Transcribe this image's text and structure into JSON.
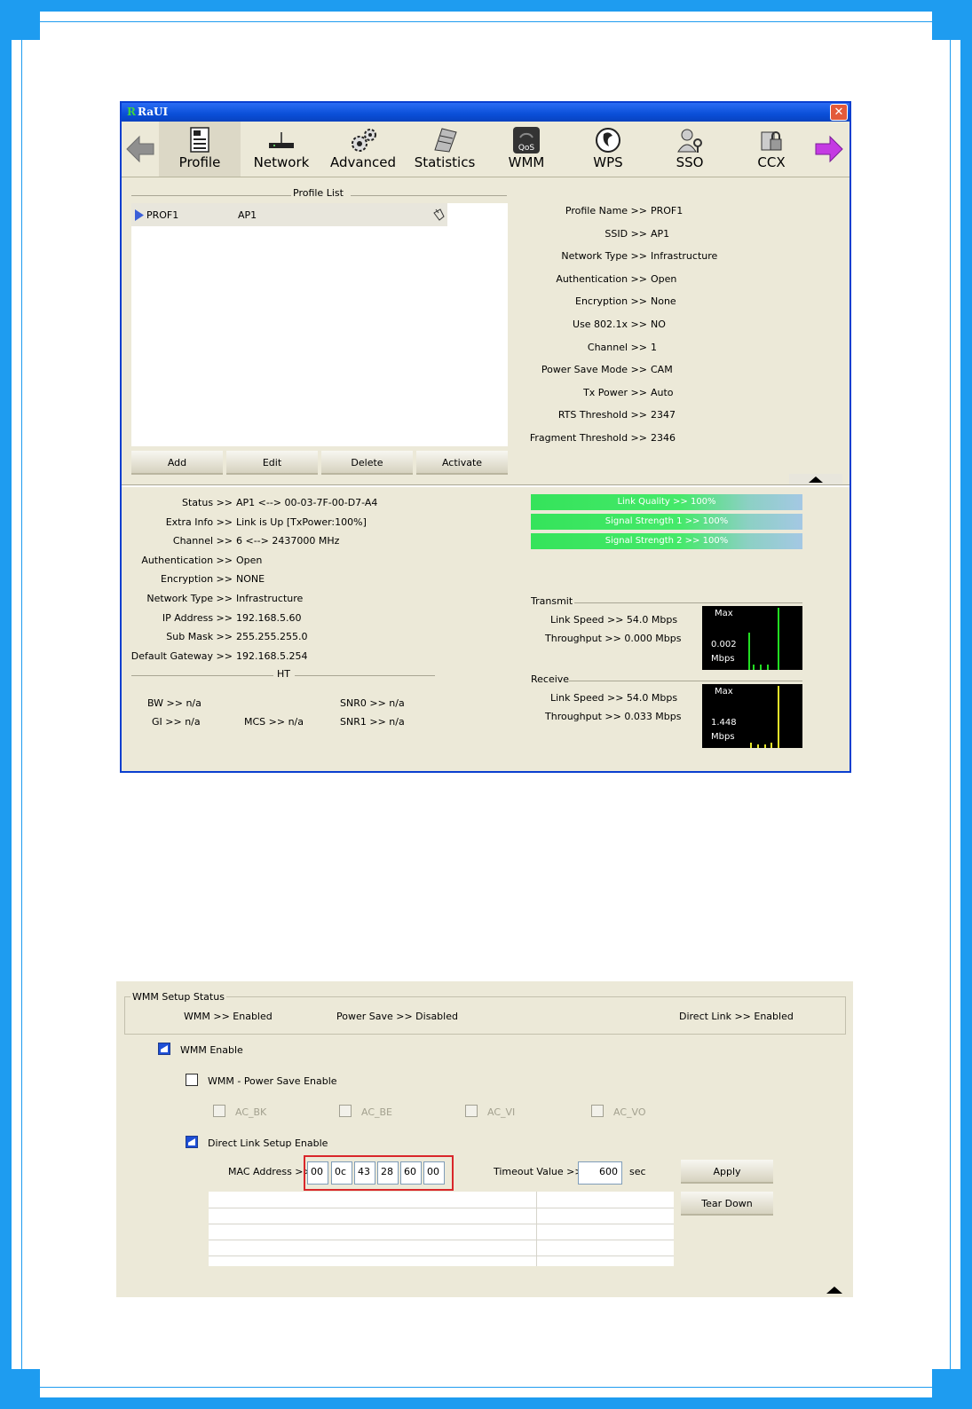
{
  "frame_color": "#1e9cf0",
  "window": {
    "title": "RaUI",
    "logo": "R",
    "close_label": "✕",
    "toolbar": [
      {
        "label": "Profile",
        "icon": "profile-icon"
      },
      {
        "label": "Network",
        "icon": "network-icon"
      },
      {
        "label": "Advanced",
        "icon": "advanced-icon"
      },
      {
        "label": "Statistics",
        "icon": "statistics-icon"
      },
      {
        "label": "WMM",
        "icon": "wmm-qos-icon"
      },
      {
        "label": "WPS",
        "icon": "wps-icon"
      },
      {
        "label": "SSO",
        "icon": "sso-icon"
      },
      {
        "label": "CCX",
        "icon": "ccx-icon"
      }
    ],
    "qos_badge": "QoS",
    "profile_list": {
      "title": "Profile List",
      "rows": [
        {
          "name": "PROF1",
          "ssid": "AP1"
        }
      ],
      "buttons": [
        "Add",
        "Edit",
        "Delete",
        "Activate"
      ]
    },
    "profile_details": [
      {
        "k": "Profile Name >>",
        "v": "PROF1"
      },
      {
        "k": "SSID >>",
        "v": "AP1"
      },
      {
        "k": "Network Type >>",
        "v": "Infrastructure"
      },
      {
        "k": "Authentication >>",
        "v": "Open"
      },
      {
        "k": "Encryption >>",
        "v": "None"
      },
      {
        "k": "Use 802.1x >>",
        "v": "NO"
      },
      {
        "k": "Channel >>",
        "v": "1"
      },
      {
        "k": "Power Save Mode >>",
        "v": "CAM"
      },
      {
        "k": "Tx Power >>",
        "v": "Auto"
      },
      {
        "k": "RTS Threshold >>",
        "v": "2347"
      },
      {
        "k": "Fragment Threshold >>",
        "v": "2346"
      }
    ],
    "status": [
      {
        "k": "Status >>",
        "v": "AP1 <--> 00-03-7F-00-D7-A4"
      },
      {
        "k": "Extra Info >>",
        "v": "Link is Up [TxPower:100%]"
      },
      {
        "k": "Channel >>",
        "v": "6 <--> 2437000 MHz"
      },
      {
        "k": "Authentication >>",
        "v": "Open"
      },
      {
        "k": "Encryption >>",
        "v": "NONE"
      },
      {
        "k": "Network Type >>",
        "v": "Infrastructure"
      },
      {
        "k": "IP Address >>",
        "v": "192.168.5.60"
      },
      {
        "k": "Sub Mask >>",
        "v": "255.255.255.0"
      },
      {
        "k": "Default Gateway >>",
        "v": "192.168.5.254"
      }
    ],
    "ht": {
      "title": "HT",
      "bw": "BW >> n/a",
      "gi": "GI >> n/a",
      "mcs": "MCS >> n/a",
      "snr0": "SNR0 >> n/a",
      "snr1": "SNR1 >> n/a"
    },
    "bars": [
      {
        "label": "Link Quality >> 100%",
        "value": 100
      },
      {
        "label": "Signal Strength 1 >> 100%",
        "value": 100
      },
      {
        "label": "Signal Strength 2 >> 100%",
        "value": 100
      }
    ],
    "transmit": {
      "title": "Transmit",
      "link_speed": "Link Speed >> 54.0 Mbps",
      "throughput": "Throughput >> 0.000 Mbps",
      "graph_max": "Max",
      "graph_value": "0.002",
      "graph_unit": "Mbps",
      "graph_color": "#22dd22"
    },
    "receive": {
      "title": "Receive",
      "link_speed": "Link Speed >> 54.0 Mbps",
      "throughput": "Throughput >> 0.033 Mbps",
      "graph_max": "Max",
      "graph_value": "1.448",
      "graph_unit": "Mbps",
      "graph_color": "#e6e62a"
    }
  },
  "wmm": {
    "setup_status_title": "WMM Setup Status",
    "wmm_status": "WMM >> Enabled",
    "power_save_status": "Power Save >> Disabled",
    "direct_link_status": "Direct Link >> Enabled",
    "wmm_enable": {
      "label": "WMM Enable",
      "checked": true
    },
    "power_save_enable": {
      "label": "WMM - Power Save Enable",
      "checked": false
    },
    "ac": [
      "AC_BK",
      "AC_BE",
      "AC_VI",
      "AC_VO"
    ],
    "dls_enable": {
      "label": "Direct Link Setup Enable",
      "checked": true
    },
    "mac_label": "MAC Address >>",
    "mac": [
      "00",
      "0c",
      "43",
      "28",
      "60",
      "00"
    ],
    "highlight_color": "#d9262a",
    "timeout_label": "Timeout Value >>",
    "timeout_value": "600",
    "timeout_unit": "sec",
    "apply": "Apply",
    "tear_down": "Tear Down"
  }
}
